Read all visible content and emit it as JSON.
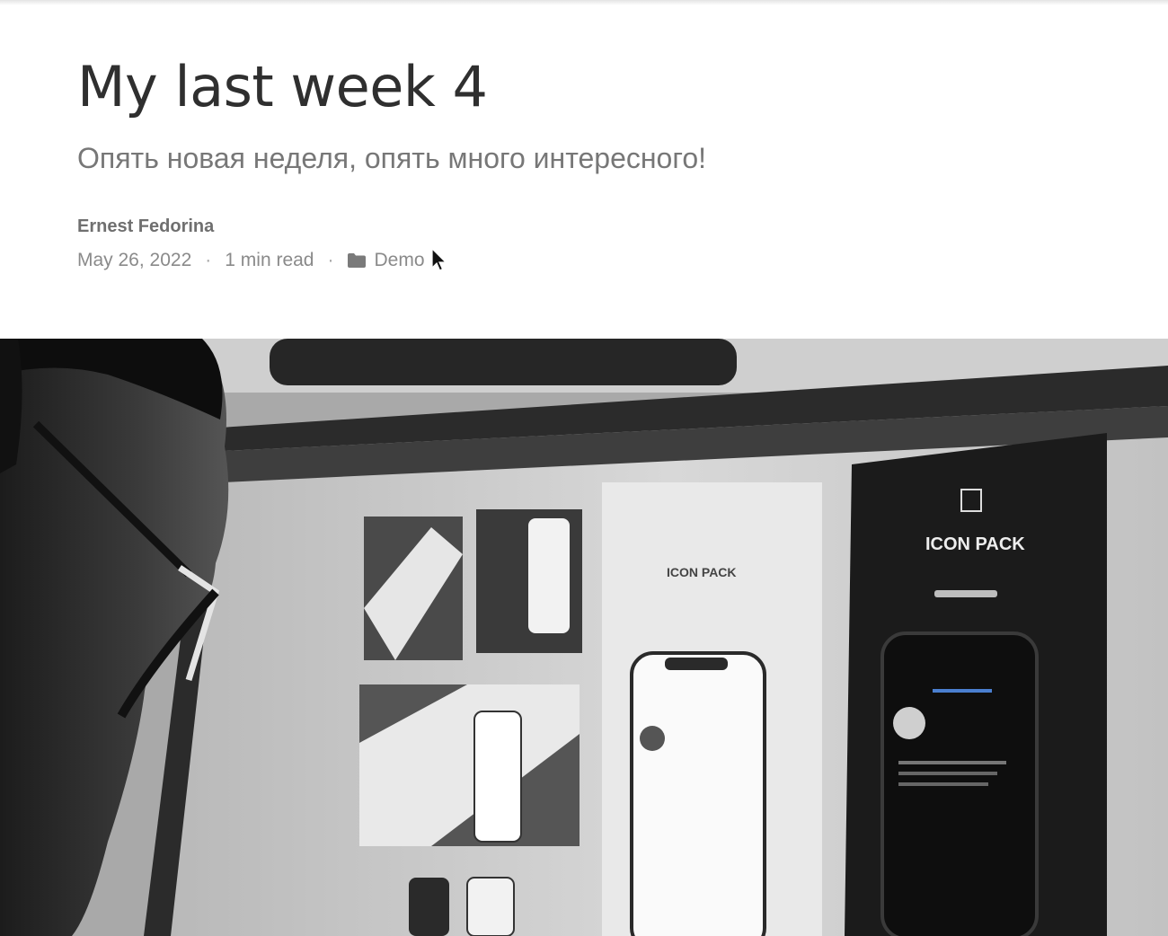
{
  "post": {
    "title": "My last week 4",
    "subtitle": "Опять новая неделя, опять много интересного!",
    "author": "Ernest Fedorina",
    "date": "May 26, 2022",
    "separator": "·",
    "reading_time": "1 min read",
    "category": "Demo",
    "category_icon": "folder-icon"
  },
  "hero_image": {
    "monitor_labels": {
      "left_panel": "ICON PACK",
      "right_panel": "ICON PACK"
    }
  }
}
